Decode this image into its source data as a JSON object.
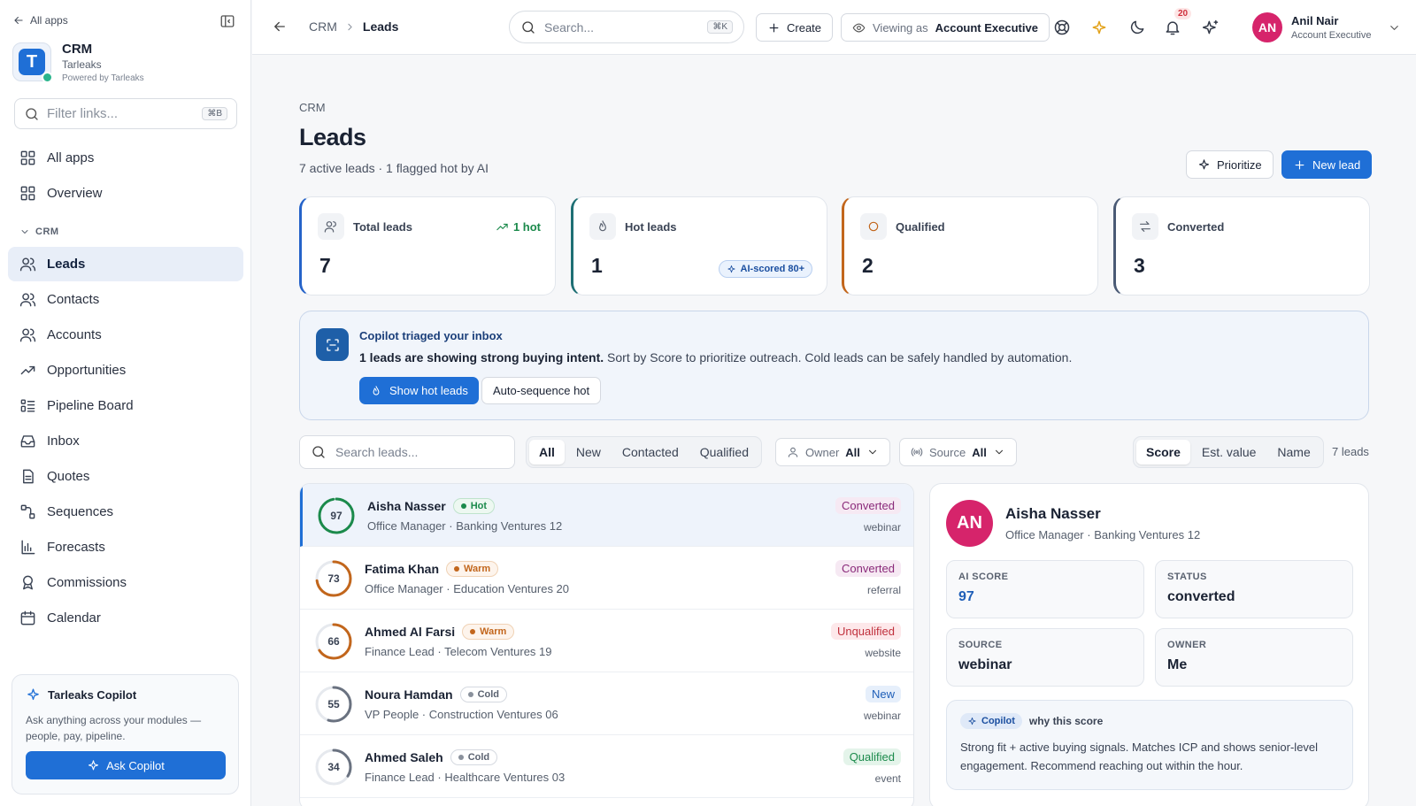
{
  "sidebar": {
    "back_label": "All apps",
    "app_name": "CRM",
    "org_name": "Tarleaks",
    "powered_by": "Powered by Tarleaks",
    "filter_placeholder": "Filter links...",
    "filter_shortcut": "⌘B",
    "top_items": [
      {
        "label": "All apps",
        "icon": "grid-icon"
      },
      {
        "label": "Overview",
        "icon": "grid-icon"
      }
    ],
    "section_label": "CRM",
    "items": [
      {
        "label": "Leads",
        "icon": "users-icon",
        "active": true
      },
      {
        "label": "Contacts",
        "icon": "users-icon"
      },
      {
        "label": "Accounts",
        "icon": "users-icon"
      },
      {
        "label": "Opportunities",
        "icon": "trending-icon"
      },
      {
        "label": "Pipeline Board",
        "icon": "kanban-icon"
      },
      {
        "label": "Inbox",
        "icon": "inbox-icon"
      },
      {
        "label": "Quotes",
        "icon": "document-icon"
      },
      {
        "label": "Sequences",
        "icon": "sequence-icon"
      },
      {
        "label": "Forecasts",
        "icon": "bar-chart-icon"
      },
      {
        "label": "Commissions",
        "icon": "award-icon"
      },
      {
        "label": "Calendar",
        "icon": "calendar-icon"
      }
    ],
    "copilot": {
      "title": "Tarleaks Copilot",
      "description": "Ask anything across your modules — people, pay, pipeline.",
      "button": "Ask Copilot"
    }
  },
  "topbar": {
    "breadcrumb_root": "CRM",
    "breadcrumb_current": "Leads",
    "search_placeholder": "Search...",
    "search_shortcut": "⌘K",
    "create_label": "Create",
    "viewing_prefix": "Viewing as",
    "viewing_role": "Account Executive",
    "notification_count": "20",
    "user_initials": "AN",
    "user_name": "Anil Nair",
    "user_role": "Account Executive"
  },
  "page": {
    "breadcrumb": "CRM",
    "title": "Leads",
    "subtitle": "7 active leads · 1 flagged hot by AI",
    "prioritize_label": "Prioritize",
    "new_lead_label": "New lead"
  },
  "kpis": [
    {
      "label": "Total leads",
      "value": "7",
      "trend": "1 hot",
      "accent": "#2563c9",
      "icon": "users-icon"
    },
    {
      "label": "Hot leads",
      "value": "1",
      "badge": "AI-scored 80+",
      "accent": "#1e6f74",
      "icon": "flame-icon"
    },
    {
      "label": "Qualified",
      "value": "2",
      "accent": "#c2661c",
      "icon": "circle-icon"
    },
    {
      "label": "Converted",
      "value": "3",
      "accent": "#4a5a75",
      "icon": "swap-icon"
    }
  ],
  "banner": {
    "title": "Copilot triaged your inbox",
    "bold_text": "1 leads are showing strong buying intent.",
    "text": " Sort by Score to prioritize outreach. Cold leads can be safely handled by automation.",
    "primary_button": "Show hot leads",
    "secondary_button": "Auto-sequence hot"
  },
  "filters": {
    "search_placeholder": "Search leads...",
    "status_tabs": [
      "All",
      "New",
      "Contacted",
      "Qualified"
    ],
    "active_status": "All",
    "owner_label": "Owner",
    "owner_value": "All",
    "source_label": "Source",
    "source_value": "All",
    "sort_tabs": [
      "Score",
      "Est. value",
      "Name"
    ],
    "active_sort": "Score",
    "count_label": "7 leads"
  },
  "leads": [
    {
      "score": 97,
      "name": "Aisha Nasser",
      "temp": "Hot",
      "title": "Office Manager · Banking Ventures 12",
      "status": "Converted",
      "source": "webinar",
      "selected": true
    },
    {
      "score": 73,
      "name": "Fatima Khan",
      "temp": "Warm",
      "title": "Office Manager · Education Ventures 20",
      "status": "Converted",
      "source": "referral"
    },
    {
      "score": 66,
      "name": "Ahmed Al Farsi",
      "temp": "Warm",
      "title": "Finance Lead · Telecom Ventures 19",
      "status": "Unqualified",
      "source": "website"
    },
    {
      "score": 55,
      "name": "Noura Hamdan",
      "temp": "Cold",
      "title": "VP People · Construction Ventures 06",
      "status": "New",
      "source": "webinar"
    },
    {
      "score": 34,
      "name": "Ahmed Saleh",
      "temp": "Cold",
      "title": "Finance Lead · Healthcare Ventures 03",
      "status": "Qualified",
      "source": "event"
    }
  ],
  "colors": {
    "accent": "#1f6fd6",
    "hot": "#1b8a4b",
    "warm": "#c2661c",
    "cold": "#8a919c",
    "status_converted": "#8a2a7a",
    "status_unqualified": "#c0303c",
    "status_new": "#1f5fb8",
    "status_qualified": "#1b8a4b"
  },
  "detail": {
    "initials": "AN",
    "name": "Aisha Nasser",
    "subtitle": "Office Manager · Banking Ventures 12",
    "fields": [
      {
        "label": "AI SCORE",
        "value": "97"
      },
      {
        "label": "STATUS",
        "value": "converted"
      },
      {
        "label": "SOURCE",
        "value": "webinar"
      },
      {
        "label": "OWNER",
        "value": "Me"
      }
    ],
    "why_chip": "Copilot",
    "why_label": "why this score",
    "why_text": "Strong fit + active buying signals. Matches ICP and shows senior-level engagement. Recommend reaching out within the hour."
  }
}
